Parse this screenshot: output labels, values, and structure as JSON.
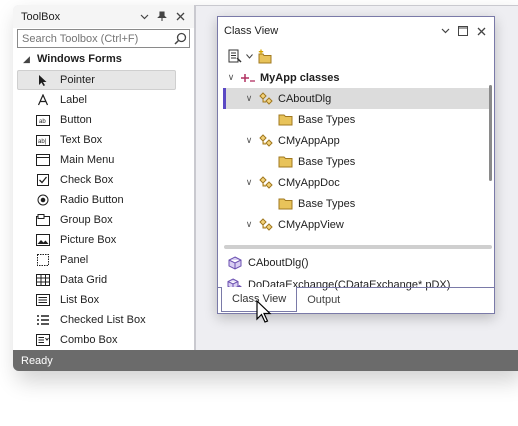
{
  "toolbox": {
    "title": "ToolBox",
    "search_placeholder": "Search Toolbox (Ctrl+F)",
    "group_label": "Windows Forms",
    "items": [
      {
        "label": "Pointer",
        "icon": "pointer-icon"
      },
      {
        "label": "Label",
        "icon": "label-icon"
      },
      {
        "label": "Button",
        "icon": "button-icon"
      },
      {
        "label": "Text Box",
        "icon": "textbox-icon"
      },
      {
        "label": "Main Menu",
        "icon": "mainmenu-icon"
      },
      {
        "label": "Check Box",
        "icon": "checkbox-icon"
      },
      {
        "label": "Radio Button",
        "icon": "radiobutton-icon"
      },
      {
        "label": "Group Box",
        "icon": "groupbox-icon"
      },
      {
        "label": "Picture Box",
        "icon": "picturebox-icon"
      },
      {
        "label": "Panel",
        "icon": "panel-icon"
      },
      {
        "label": "Data Grid",
        "icon": "datagrid-icon"
      },
      {
        "label": "List Box",
        "icon": "listbox-icon"
      },
      {
        "label": "Checked List Box",
        "icon": "checkedlistbox-icon"
      },
      {
        "label": "Combo Box",
        "icon": "combobox-icon"
      }
    ],
    "selected_index": 0
  },
  "class_view": {
    "title": "Class View",
    "root_label": "MyApp classes",
    "tree": [
      {
        "label": "CAboutDlg",
        "type": "class",
        "selected": true
      },
      {
        "label": "Base Types",
        "type": "folder"
      },
      {
        "label": "CMyAppApp",
        "type": "class"
      },
      {
        "label": "Base Types",
        "type": "folder"
      },
      {
        "label": "CMyAppDoc",
        "type": "class"
      },
      {
        "label": "Base Types",
        "type": "folder"
      },
      {
        "label": "CMyAppView",
        "type": "class"
      }
    ],
    "members": [
      {
        "label": "CAboutDlg()",
        "icon": "method-icon"
      },
      {
        "label": "DoDataExchange(CDataExchange* pDX)",
        "icon": "protected-method-icon"
      }
    ],
    "tabs": [
      {
        "label": "Class View",
        "active": true
      },
      {
        "label": "Output",
        "active": false
      }
    ]
  },
  "status_bar": {
    "text": "Ready"
  },
  "colors": {
    "status_bar_bg": "#6b6b6b",
    "selection_accent": "#5b49c4",
    "window_border": "#7a7aa8",
    "folder_yellow": "#e8c35a"
  }
}
